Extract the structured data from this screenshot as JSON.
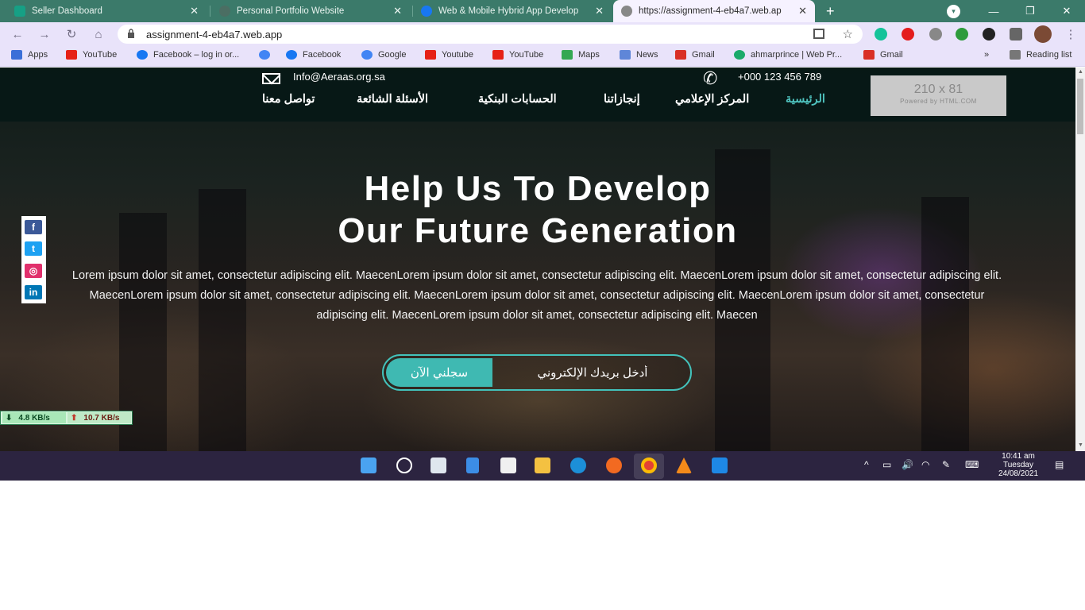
{
  "browser": {
    "tabs": [
      {
        "title": "Seller Dashboard",
        "active": false
      },
      {
        "title": "Personal Portfolio Website",
        "active": false
      },
      {
        "title": "Web & Mobile Hybrid App Develop",
        "active": false
      },
      {
        "title": "https://assignment-4-eb4a7.web.ap",
        "active": true
      }
    ],
    "url": "assignment-4-eb4a7.web.app",
    "bookmarks": [
      {
        "label": "Apps",
        "icon": "apps-grid-icon",
        "color": "#3b6fd8"
      },
      {
        "label": "YouTube",
        "icon": "youtube-icon",
        "color": "#e62117"
      },
      {
        "label": "Facebook – log in or...",
        "icon": "facebook-icon",
        "color": "#1877f2"
      },
      {
        "label": "",
        "icon": "google-icon",
        "color": "#4285f4"
      },
      {
        "label": "Facebook",
        "icon": "facebook-icon",
        "color": "#1877f2"
      },
      {
        "label": "Google",
        "icon": "google-icon",
        "color": "#4285f4"
      },
      {
        "label": "Youtube",
        "icon": "youtube-icon",
        "color": "#e62117"
      },
      {
        "label": "YouTube",
        "icon": "youtube-icon",
        "color": "#e62117"
      },
      {
        "label": "Maps",
        "icon": "maps-icon",
        "color": "#34a853"
      },
      {
        "label": "News",
        "icon": "news-icon",
        "color": "#5f86d8"
      },
      {
        "label": "Gmail",
        "icon": "gmail-icon",
        "color": "#d93025"
      },
      {
        "label": "ahmarprince | Web Pr...",
        "icon": "site-icon",
        "color": "#1aaa6a"
      },
      {
        "label": "Gmail",
        "icon": "gmail-icon",
        "color": "#d93025"
      }
    ],
    "overflow": "»",
    "reading_list": "Reading list"
  },
  "site": {
    "email": "Info@Aeraas.org.sa",
    "phone": "+000 123 456 789",
    "nav": [
      "الرئيسية",
      "المركز الإعلامي",
      "إنجازاتنا",
      "الحسابات البنكية",
      "الأسئلة الشائعة",
      "تواصل معنا"
    ],
    "logo_placeholder": {
      "size": "210 x 81",
      "caption": "Powered by HTML.COM"
    },
    "hero": {
      "title_line1": "Help Us To Develop",
      "title_line2": "Our Future Generation",
      "text": "Lorem ipsum dolor sit amet, consectetur adipiscing elit. MaecenLorem ipsum dolor sit amet, consectetur adipiscing elit. MaecenLorem ipsum dolor sit amet, consectetur adipiscing elit. MaecenLorem ipsum dolor sit amet, consectetur adipiscing elit. MaecenLorem ipsum dolor sit amet, consectetur adipiscing elit. MaecenLorem ipsum dolor sit amet, consectetur adipiscing elit. MaecenLorem ipsum dolor sit amet, consectetur adipiscing elit. Maecen",
      "signup_button": "سجلني الآن",
      "signup_placeholder": "أدخل بريدك الإلكتروني"
    },
    "social": [
      "facebook",
      "twitter",
      "instagram",
      "linkedin"
    ]
  },
  "netspeed": {
    "down": "4.8 KB/s",
    "up": "10.7 KB/s"
  },
  "taskbar": {
    "apps": [
      "start",
      "search",
      "task-view",
      "widgets",
      "store",
      "file-explorer",
      "edge",
      "firefox",
      "chrome",
      "vlc",
      "vscode"
    ],
    "clock_time": "10:41 am",
    "clock_day": "Tuesday",
    "clock_date": "24/08/2021"
  },
  "colors": {
    "accent": "#43c2bb",
    "tabstrip": "#3b7a6a",
    "toolbar": "#e9e3fa"
  }
}
